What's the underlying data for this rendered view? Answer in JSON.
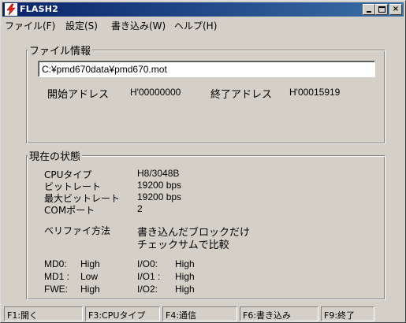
{
  "window": {
    "title": "FLASH2",
    "icon": "lightning-icon",
    "controls": {
      "minimize": "minimize-icon",
      "maximize": "maximize-icon",
      "close": "×"
    }
  },
  "menu": [
    "ファイル(F)",
    "設定(S)",
    "書き込み(W)",
    "ヘルプ(H)"
  ],
  "file_info": {
    "group_label": "ファイル情報",
    "path": "C:¥pmd670data¥pmd670.mot",
    "start_label": "開始アドレス",
    "start_value": "H'00000000",
    "end_label": "終了アドレス",
    "end_value": "H'00015919"
  },
  "status": {
    "group_label": "現在の状態",
    "cpu_label": "CPUタイプ",
    "cpu_value": "H8/3048B",
    "bitrate_label": "ビットレート",
    "bitrate_value": "19200 bps",
    "maxbitrate_label": "最大ビットレート",
    "maxbitrate_value": "19200 bps",
    "comport_label": "COMポート",
    "comport_value": "2",
    "verify_label": "ベリファイ方法",
    "verify_value_line1": "書き込んだブロックだけ",
    "verify_value_line2": "チェックサムで比較",
    "md0_label": "MD0:",
    "md0_value": "High",
    "md1_label": "MD1 :",
    "md1_value": "Low",
    "fwe_label": "FWE:",
    "fwe_value": "High",
    "io0_label": "I/O0:",
    "io0_value": "High",
    "io1_label": "I/O1 :",
    "io1_value": "High",
    "io2_label": "I/O2:",
    "io2_value": "High"
  },
  "statusbar": [
    "F1:開く",
    "F3:CPUタイプ",
    "F4:通信",
    "F6:書き込み",
    "F9:終了"
  ],
  "colors": {
    "face": "#d4d0c8",
    "title_start": "#0a246a",
    "title_end": "#3a6ea5",
    "icon_accent": "#e8201c"
  }
}
